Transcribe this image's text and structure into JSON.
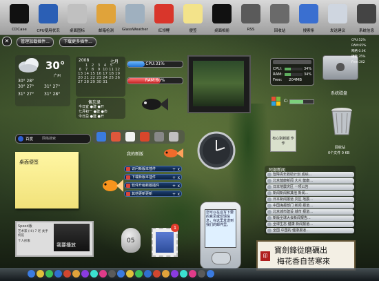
{
  "top_dock": {
    "items": [
      {
        "label": "CDCase",
        "icon": "cd-icon",
        "color": "#111111"
      },
      {
        "label": "CPU使用状况",
        "icon": "cpu-icon",
        "color": "#2b5fb5"
      },
      {
        "label": "桌面图标",
        "icon": "grid-icon",
        "color": "#c0c0c0"
      },
      {
        "label": "邮箱检测",
        "icon": "mail-check-icon",
        "color": "#e0a33a"
      },
      {
        "label": "GlassWeather",
        "icon": "weather-icon",
        "color": "#9fb0bf"
      },
      {
        "label": "红领鲤",
        "icon": "fish-icon",
        "color": "#d9362b"
      },
      {
        "label": "便签",
        "icon": "note-icon",
        "color": "#f3e38a"
      },
      {
        "label": "桌面相册",
        "icon": "album-icon",
        "color": "#111111"
      },
      {
        "label": "RSS",
        "icon": "rss-icon",
        "color": "#5a5a5a"
      },
      {
        "label": "回收站",
        "icon": "trash-icon",
        "color": "#6a6a6a"
      },
      {
        "label": "搜索条",
        "icon": "search-bar-icon",
        "color": "#3a6fd0"
      },
      {
        "label": "发送建议",
        "icon": "phone-icon",
        "color": "#cfd6e0"
      },
      {
        "label": "系统信息",
        "icon": "system-info-icon",
        "color": "#444444"
      }
    ]
  },
  "top_buttons": {
    "close_symbol": "✕",
    "manage": "管理加载插件...",
    "download": "下载更多插件..."
  },
  "weather": {
    "temp": "30°",
    "city": "广州",
    "current": "30°  28°",
    "forecast": [
      {
        "day": "30°",
        "low": "27°"
      },
      {
        "day": "31°",
        "low": "27°"
      },
      {
        "day": "31°",
        "low": "27°"
      },
      {
        "day": "31°",
        "low": "28°"
      }
    ]
  },
  "calendar": {
    "year": "2008",
    "month": "七月",
    "rows": [
      [
        "",
        "1",
        "2",
        "3",
        "4",
        "5"
      ],
      [
        "6",
        "7",
        "8",
        "9",
        "10",
        "11",
        "12"
      ],
      [
        "13",
        "14",
        "15",
        "16",
        "17",
        "18",
        "19"
      ],
      [
        "20",
        "21",
        "22",
        "23",
        "24",
        "25",
        "26"
      ],
      [
        "27",
        "28",
        "29",
        "30",
        "31"
      ]
    ],
    "almanac_title": "备忘录",
    "almanac_lines": [
      "今日宜  ●建 ●开",
      "七月初一 ●建 ●市",
      "今日忌  ●建 ●开"
    ]
  },
  "meters": {
    "cpu_label": "CPU:31%",
    "cpu_level": 0.31,
    "ram_label": "RAM:60%",
    "ram_level": 0.6
  },
  "search": {
    "engine": "百度",
    "placeholder": "网络搜索"
  },
  "toolbar_icons": [
    "globe-icon",
    "people-icon",
    "calendar-icon",
    "magnet-icon",
    "toolbox-icon",
    "tools-icon"
  ],
  "note": {
    "text": "桌面便签"
  },
  "photo": {
    "header": "Speed版",
    "caption": "艺术家 (Hi) 7 老 关手机馆",
    "caption2": "个人形象",
    "overlay": "我要播放"
  },
  "my_gadgets": {
    "title": "我的新版",
    "items": [
      "访问新版本插件",
      "下载新版本插件",
      "软件升级新版插件",
      "其他更新更新"
    ],
    "plus": "+",
    "close": "x"
  },
  "sysinfo": {
    "cpu": "CPU:",
    "cpu_val": "34%",
    "ram": "RAM:",
    "ram_val": "34%",
    "free": "Free:",
    "free_val": "204MB",
    "cpu_level": 0.34,
    "ram_level": 0.34
  },
  "disk": {
    "label": "C:",
    "level": 0.55
  },
  "mac_widget": {
    "title": "系统磁盘"
  },
  "recycle": {
    "caption": "回收站",
    "sub": "0个文件 0 KB"
  },
  "rss_news": {
    "title": "阿部新闻",
    "items": [
      "智障青年救助计划 成绩...",
      "北京健康新闻 大众 健康...",
      "日本地震灾区 一项公告",
      "新闻新闻和其他 新闻...",
      "日本新闻报道 灾区 地震...",
      "中国海报部门 新闻 报道...",
      "北京城市建设 城市 报道...",
      "新版全球大会新闻报告...",
      "全球生态 健康 新闻报道...",
      "全国 中国的 健康报道..."
    ]
  },
  "phone": {
    "text": "您可以在这写下要的意见或反馈信息，在这里发送到我们的邮件里。"
  },
  "calligraphy": {
    "line1": "寶劍鋒從磨礪出",
    "line2": "梅花香自苦寒來",
    "seal": "印"
  },
  "right_side": {
    "lines": [
      "CPU:52%",
      "RAM:65%",
      "网络 0.0K",
      "硬盘 35%",
      "Free:202"
    ]
  },
  "egg_timer": {
    "value": "05"
  },
  "mail_badge": "1",
  "tablet_sign": {
    "text": "有心别新版 作作"
  },
  "bottom_dock": {
    "icons": [
      "start-icon",
      "chat-icon",
      "media-icon",
      "ie-icon",
      "browser-icon",
      "folder-icon",
      "music-icon",
      "game-icon",
      "photo-icon",
      "mail-icon",
      "msn-icon",
      "qq-icon",
      "settings-icon",
      "tools-icon",
      "network-icon",
      "help-icon",
      "clock-icon",
      "shield-icon",
      "update-icon",
      "desktop-icon",
      "power-icon"
    ]
  }
}
